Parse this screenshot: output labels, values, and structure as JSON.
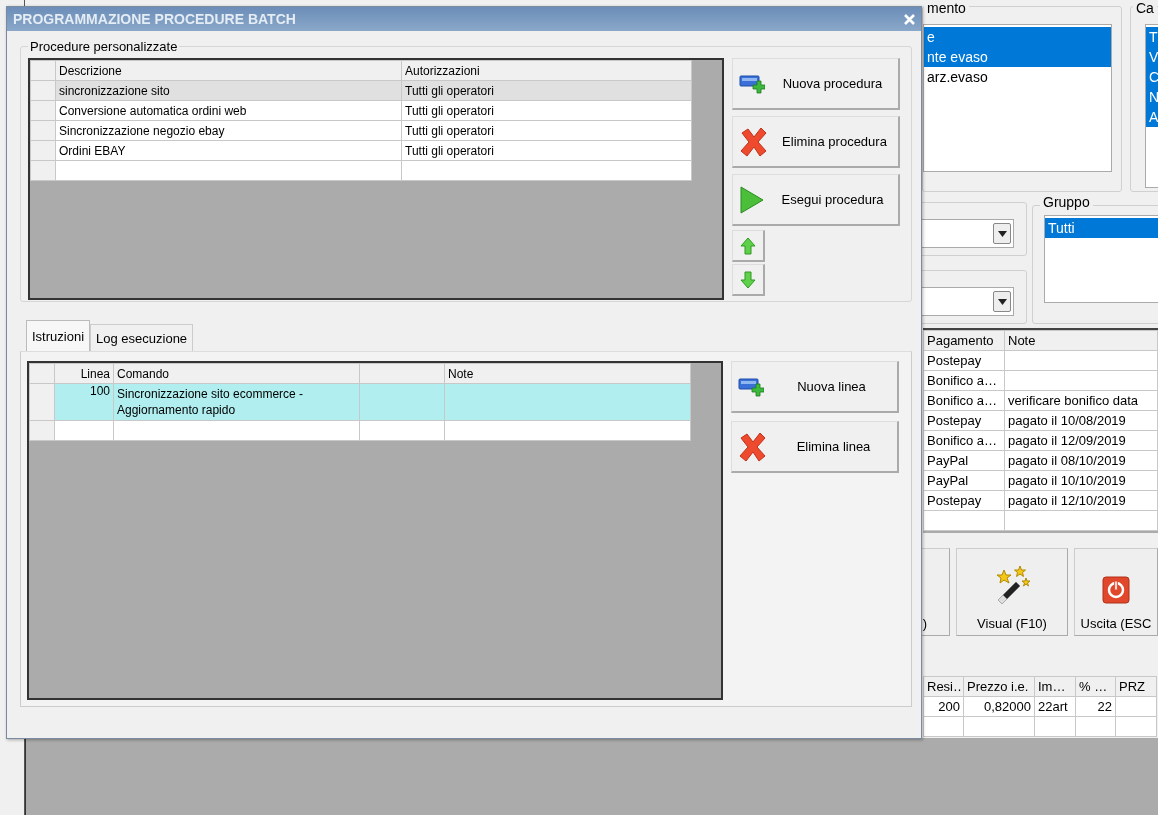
{
  "background": {
    "status_group": {
      "title": "mento",
      "items": [
        {
          "text": "e",
          "selected": true
        },
        {
          "text": "nte evaso",
          "selected": true
        },
        {
          "text": "arz.evaso",
          "selected": false
        }
      ]
    },
    "category_group": {
      "title": "Ca",
      "items": [
        {
          "text": "T",
          "selected": true
        },
        {
          "text": "V",
          "selected": true
        },
        {
          "text": "C",
          "selected": true
        },
        {
          "text": "N",
          "selected": true
        },
        {
          "text": "A",
          "selected": true
        }
      ]
    },
    "group_filter": {
      "title": "Gruppo",
      "items": [
        {
          "text": "Tutti",
          "selected": true
        }
      ]
    },
    "payments_table": {
      "columns": [
        "Pagamento",
        "Note"
      ],
      "rows": [
        {
          "payment": "Postepay"
        },
        {
          "payment": "Bonifico a…"
        },
        {
          "payment": "Bonifico a…",
          "note": "verificare bonifico data"
        },
        {
          "payment": "Postepay",
          "note": "pagato il  10/08/2019"
        },
        {
          "payment": "Bonifico a…",
          "note": "pagato il 12/09/2019"
        },
        {
          "payment": "PayPal",
          "note": "pagato il 08/10/2019"
        },
        {
          "payment": "PayPal",
          "note": "pagato il 10/10/2019"
        },
        {
          "payment": "Postepay",
          "note": "pagato il 12/10/2019"
        }
      ]
    },
    "actions": [
      {
        "label": ")",
        "kind": "plain"
      },
      {
        "label": "Visual (F10)",
        "kind": "wand"
      },
      {
        "label": "Uscita (ESC",
        "kind": "power"
      }
    ],
    "lines_table": {
      "columns": [
        "Resi…",
        "Prezzo i.e.",
        "Im…",
        "% …",
        "PRZ"
      ],
      "rows": [
        [
          "200",
          "0,82000",
          "22art",
          "22"
        ]
      ]
    }
  },
  "dialog": {
    "title": "PROGRAMMAZIONE PROCEDURE BATCH",
    "procedures": {
      "title": "Procedure personalizzate",
      "columns": [
        "Descrizione",
        "Autorizzazioni"
      ],
      "rows": [
        {
          "description": "sincronizzazione sito",
          "authorization": "Tutti gli operatori",
          "selected": true
        },
        {
          "description": "Conversione automatica ordini web",
          "authorization": "Tutti gli operatori",
          "selected": false
        },
        {
          "description": "Sincronizzazione negozio ebay",
          "authorization": "Tutti gli operatori",
          "selected": false
        },
        {
          "description": "Ordini EBAY",
          "authorization": "Tutti gli operatori",
          "selected": false
        }
      ]
    },
    "procedure_buttons": [
      {
        "label": "Nuova procedura",
        "kind": "add"
      },
      {
        "label": "Elimina procedura",
        "kind": "delete"
      },
      {
        "label": "Esegui procedura",
        "kind": "run"
      }
    ],
    "move_buttons": [
      {
        "kind": "up"
      },
      {
        "kind": "down"
      }
    ],
    "tabs": [
      {
        "label": "Istruzioni",
        "selected": true
      },
      {
        "label": "Log esecuzione",
        "selected": false
      }
    ],
    "instructions": {
      "columns": [
        "Linea",
        "Comando",
        "Note"
      ],
      "rows": [
        {
          "line": "100",
          "command": "Sincronizzazione sito ecommerce - Aggiornamento rapido",
          "selected": true
        }
      ]
    },
    "line_buttons": [
      {
        "label": "Nuova linea",
        "kind": "add"
      },
      {
        "label": "Elimina linea",
        "kind": "delete"
      }
    ]
  }
}
